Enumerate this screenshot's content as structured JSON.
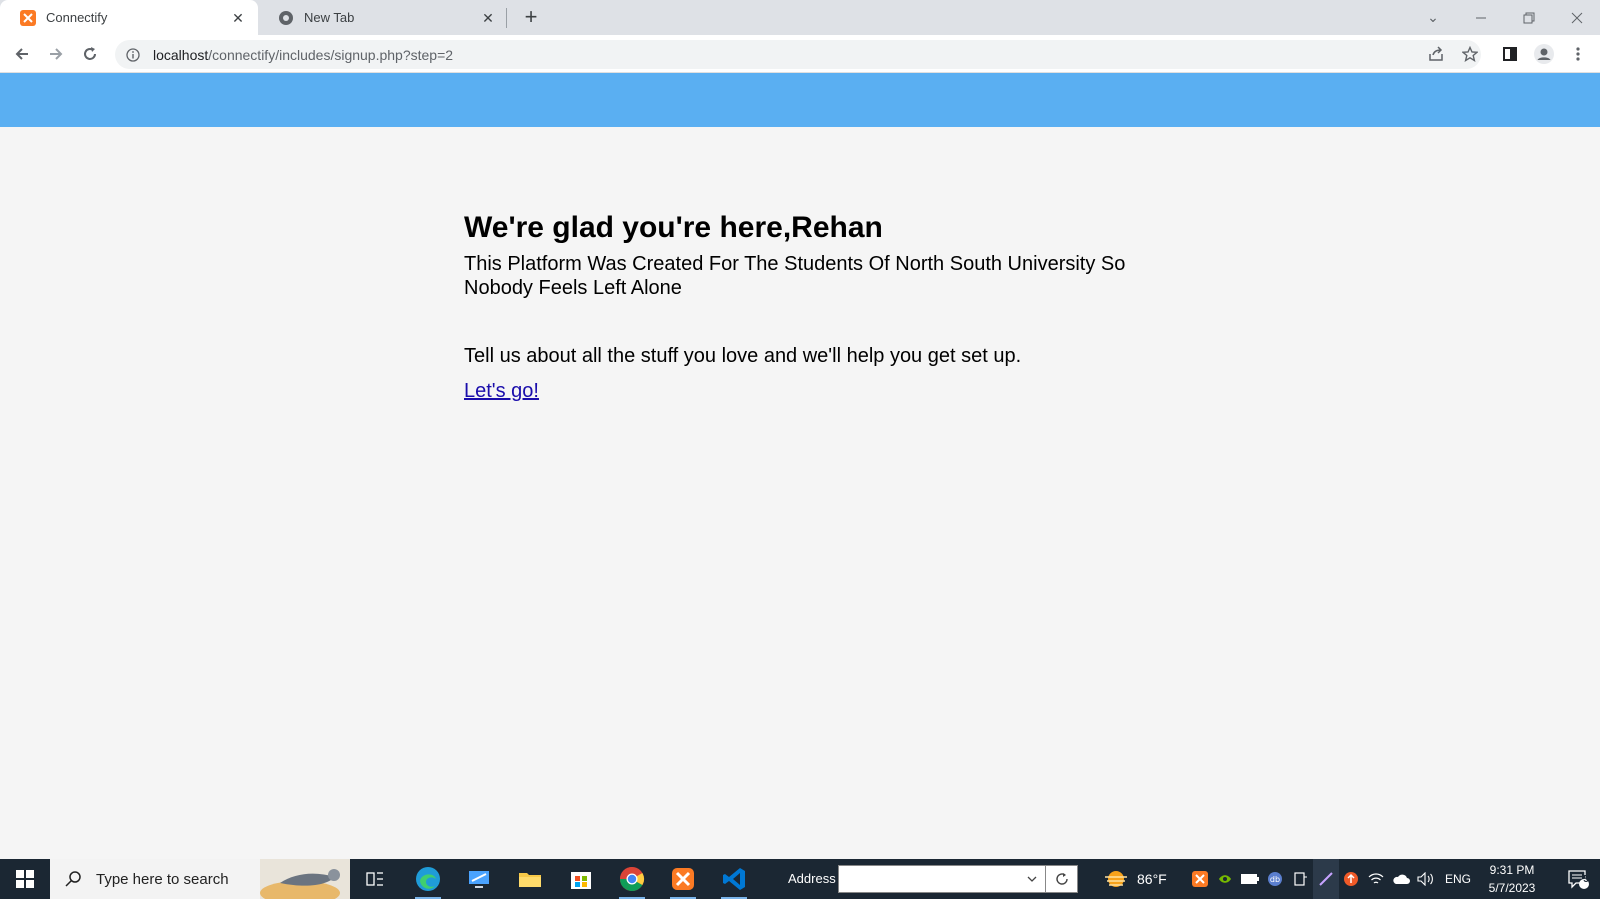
{
  "browser": {
    "tabs": [
      {
        "title": "Connectify",
        "active": true,
        "icon": "xampp-icon"
      },
      {
        "title": "New Tab",
        "active": false,
        "icon": "chrome-icon"
      }
    ],
    "address": {
      "host": "localhost",
      "path": "/connectify/includes/signup.php?step=2"
    }
  },
  "page": {
    "banner_color": "#5aaff2",
    "heading": "We're glad you're here,Rehan",
    "lead": "This Platform Was Created For The Students Of North South University So Nobody Feels Left Alone",
    "tell": "Tell us about all the stuff you love and we'll help you get set up.",
    "link": "Let's go!"
  },
  "taskbar": {
    "search_placeholder": "Type here to search",
    "address_label": "Address",
    "address_value": "",
    "weather": "86°F",
    "language": "ENG",
    "time": "9:31 PM",
    "date": "5/7/2023",
    "notifications": "5"
  }
}
